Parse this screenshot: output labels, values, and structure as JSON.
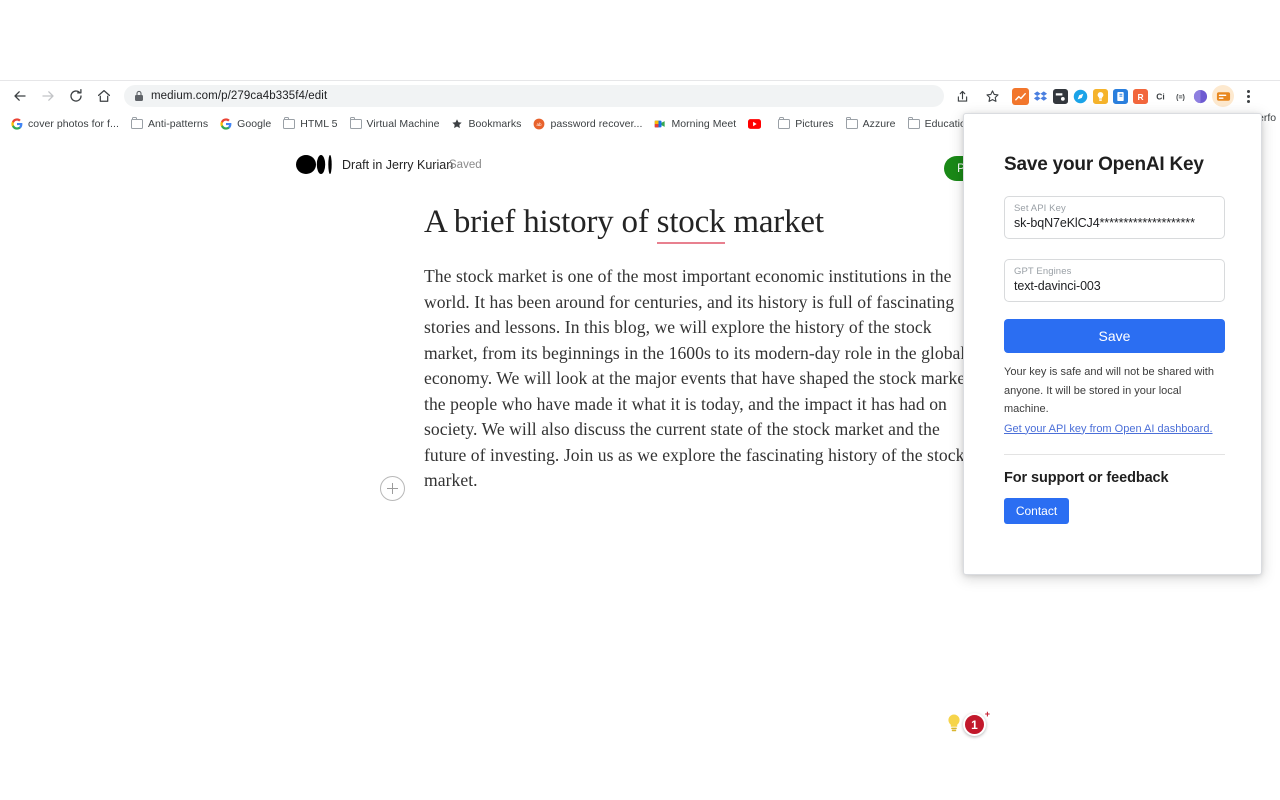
{
  "browser": {
    "nav": {
      "back_label": "Back",
      "forward_label": "Forward",
      "reload_label": "Reload",
      "home_label": "Home"
    },
    "omnibox": {
      "url": "medium.com/p/279ca4b335f4/edit",
      "lock_icon": "lock-icon",
      "share_icon": "share-icon",
      "bookmark_icon": "star-icon"
    },
    "extensions": [
      {
        "name": "chart-extension-icon",
        "glyph": "↗",
        "bg": "#f08030"
      },
      {
        "name": "dropbox-extension-icon",
        "glyph": "❖",
        "bg": "#3b7ae0"
      },
      {
        "name": "dark-extension-icon",
        "glyph": "■",
        "bg": "#2f3338"
      },
      {
        "name": "compass-extension-icon",
        "glyph": "●",
        "bg": "#1a9df0"
      },
      {
        "name": "bulb-extension-icon",
        "glyph": "●",
        "bg": "#f5b128"
      },
      {
        "name": "blue-note-extension-icon",
        "glyph": "■",
        "bg": "#2a7fdd"
      },
      {
        "name": "orange-r-extension-icon",
        "glyph": "R",
        "bg": "#f0603a"
      },
      {
        "name": "ci-extension-icon",
        "glyph": "Ci",
        "bg": "transparent"
      },
      {
        "name": "equals-extension-icon",
        "glyph": "(=)",
        "bg": "transparent"
      },
      {
        "name": "purple-orb-extension-icon",
        "glyph": "●",
        "bg": "#6d5ad1"
      }
    ],
    "active_extension": {
      "name": "openai-key-extension-icon",
      "bg": "#e8871e"
    },
    "menu_label": "Chrome menu",
    "bookmarks": [
      {
        "label": "cover photos for f...",
        "icon": "google-icon"
      },
      {
        "label": "Anti-patterns",
        "icon": "folder-icon"
      },
      {
        "label": "Google",
        "icon": "google-icon"
      },
      {
        "label": "HTML 5",
        "icon": "folder-icon"
      },
      {
        "label": "Virtual Machine",
        "icon": "folder-icon"
      },
      {
        "label": "Bookmarks",
        "icon": "star-icon"
      },
      {
        "label": "password recover...",
        "icon": "orange-circle-icon"
      },
      {
        "label": "Morning Meet",
        "icon": "google-meet-icon"
      },
      {
        "label": "",
        "icon": "youtube-icon"
      },
      {
        "label": "Pictures",
        "icon": "folder-icon"
      },
      {
        "label": "Azzure",
        "icon": "folder-icon"
      },
      {
        "label": "Education",
        "icon": "folder-icon"
      }
    ],
    "bookmark_clipped": "erfo"
  },
  "medium": {
    "logo_name": "medium-logo",
    "draft_status": "Draft in Jerry Kurian",
    "saved_status": "Saved",
    "publish_label": "Publish",
    "title_prefix": "A brief history of ",
    "title_misspelled": "stock",
    "title_suffix": " market",
    "body": "The stock market is one of the most important economic institutions in the world. It has been around for centuries, and its history is full of fascinating stories and lessons. In this blog, we will explore the history of the stock market, from its beginnings in the 1600s to its modern-day role in the global economy. We will look at the major events that have shaped the stock market, the people who have made it what it is today, and the impact it has had on society. We will also discuss the current state of the stock market and the future of investing. Join us as we explore the fascinating history of the stock market.",
    "add_block_label": "+"
  },
  "widgets": {
    "bulb_icon": "lightbulb-icon",
    "badge_count": "1",
    "badge_plus": "+"
  },
  "popup": {
    "title": "Save your OpenAI Key",
    "api_key_field": {
      "label": "Set API Key",
      "value": "sk-bqN7eKlCJ4********************"
    },
    "engine_field": {
      "label": "GPT Engines",
      "value": "text-davinci-003"
    },
    "save_label": "Save",
    "note": "Your key is safe and will not be shared with anyone. It will be stored in your local machine.",
    "note_link": "Get your API key from Open AI dashboard.",
    "support_title": "For support or feedback",
    "contact_label": "Contact",
    "accent_color": "#2b6ef2"
  }
}
